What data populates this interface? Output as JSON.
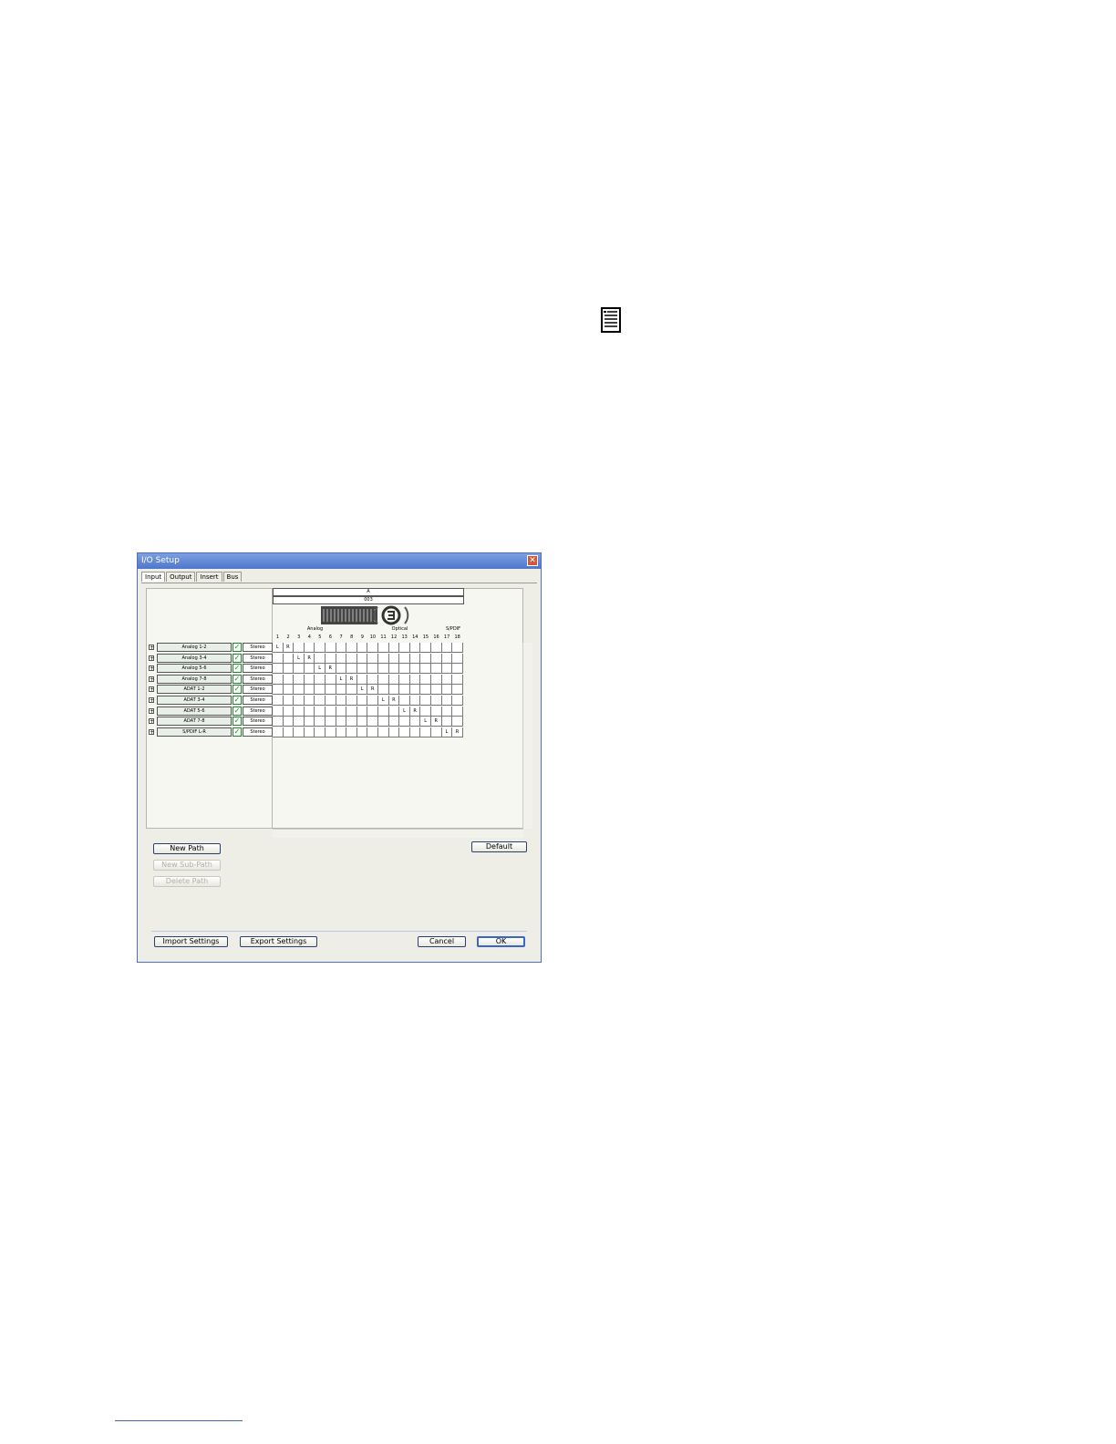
{
  "dialog": {
    "title": "I/O Setup",
    "tabs": [
      "Input",
      "Output",
      "Insert",
      "Bus"
    ],
    "active_tab": "Input",
    "device_top_label": "A",
    "device_name": "003",
    "groups": [
      "Analog",
      "Optical",
      "S/PDIF"
    ],
    "columns": [
      "1",
      "2",
      "3",
      "4",
      "5",
      "6",
      "7",
      "8",
      "9",
      "10",
      "11",
      "12",
      "13",
      "14",
      "15",
      "16",
      "17",
      "18"
    ],
    "paths": [
      {
        "name": "Analog 1-2",
        "format": "Stereo",
        "L": 1,
        "R": 2
      },
      {
        "name": "Analog 3-4",
        "format": "Stereo",
        "L": 3,
        "R": 4
      },
      {
        "name": "Analog 5-6",
        "format": "Stereo",
        "L": 5,
        "R": 6
      },
      {
        "name": "Analog 7-8",
        "format": "Stereo",
        "L": 7,
        "R": 8
      },
      {
        "name": "ADAT 1-2",
        "format": "Stereo",
        "L": 9,
        "R": 10
      },
      {
        "name": "ADAT 3-4",
        "format": "Stereo",
        "L": 11,
        "R": 12
      },
      {
        "name": "ADAT 5-6",
        "format": "Stereo",
        "L": 13,
        "R": 14
      },
      {
        "name": "ADAT 7-8",
        "format": "Stereo",
        "L": 15,
        "R": 16
      },
      {
        "name": "S/PDIF L-R",
        "format": "Stereo",
        "L": 17,
        "R": 18
      }
    ],
    "buttons": {
      "new_path": "New Path",
      "new_sub_path": "New Sub-Path",
      "delete_path": "Delete Path",
      "default": "Default",
      "import_settings": "Import Settings",
      "export_settings": "Export Settings",
      "cancel": "Cancel",
      "ok": "OK"
    },
    "icons": {
      "expand": "expand-plus-icon",
      "check": "checkbox-checked-icon",
      "close": "close-icon"
    }
  },
  "page": {
    "note_icon": "document-note-icon"
  }
}
